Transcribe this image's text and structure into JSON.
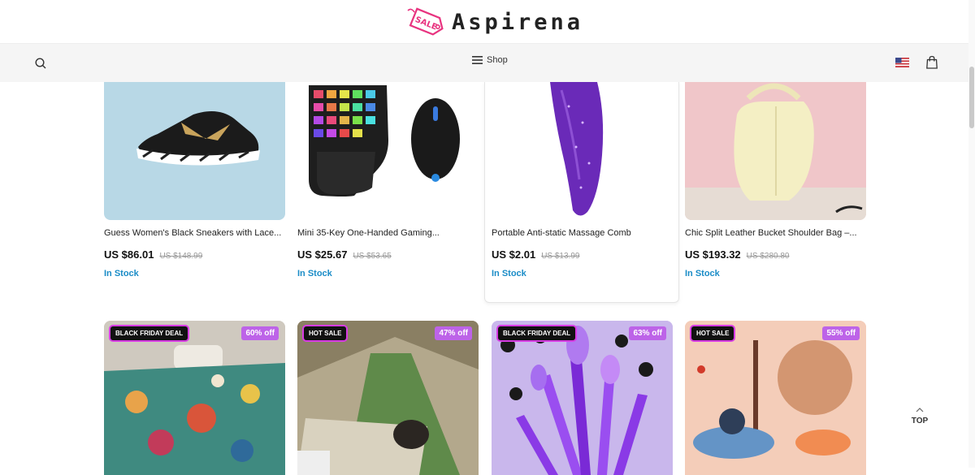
{
  "brand": {
    "name": "Aspirena",
    "tag_text": "SALE"
  },
  "nav": {
    "shop_label": "Shop"
  },
  "products": [
    {
      "name": "Guess Women's Black Sneakers with Lace...",
      "price": "US $86.01",
      "old_price": "US $148.99",
      "stock": "In Stock"
    },
    {
      "name": "Mini 35-Key One-Handed Gaming...",
      "price": "US $25.67",
      "old_price": "US $53.65",
      "stock": "In Stock"
    },
    {
      "name": "Portable Anti-static Massage Comb",
      "price": "US $2.01",
      "old_price": "US $13.99",
      "stock": "In Stock"
    },
    {
      "name": "Chic Split Leather Bucket Shoulder Bag –...",
      "price": "US $193.32",
      "old_price": "US $280.80",
      "stock": "In Stock"
    }
  ],
  "deals": [
    {
      "badge": "BLACK FRIDAY DEAL",
      "discount": "60% off"
    },
    {
      "badge": "HOT SALE",
      "discount": "47% off"
    },
    {
      "badge": "BLACK FRIDAY DEAL",
      "discount": "63% off"
    },
    {
      "badge": "HOT SALE",
      "discount": "55% off"
    }
  ],
  "back_to_top": {
    "label": "TOP"
  },
  "colors": {
    "accent": "#d83be4",
    "stock": "#1a8cc7",
    "discount_bg": "#bd63e8"
  }
}
